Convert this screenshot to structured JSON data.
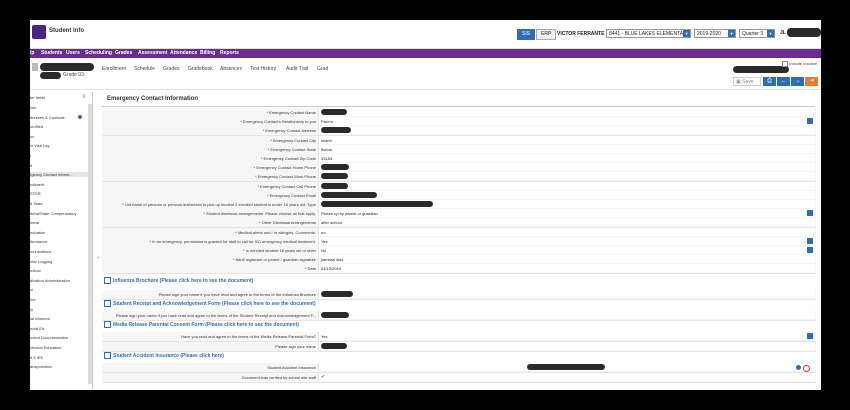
{
  "app": {
    "title": "Student Info"
  },
  "topbar": {
    "btn_sis": "SIS",
    "btn_erp": "ERP",
    "user_name": "VICTOR FERRANTE",
    "school": "8441 - BLUE LAKES ELEMENTA...",
    "year": "2019-2020",
    "quarter": "Quarter 3",
    "trailing_initial": "JL"
  },
  "nav": [
    "Students",
    "Users",
    "Scheduling",
    "Grades",
    "Assessment",
    "Attendance",
    "Billing",
    "Reports"
  ],
  "student": {
    "grade": "Grade 03"
  },
  "subtabs": [
    "Enrollment",
    "Schedule",
    "Grades",
    "Gradebook",
    "Absences",
    "Test History",
    "Audit Trail",
    "Grad"
  ],
  "include_inactive": "Include Inactive",
  "toolbar": {
    "save": "Save"
  },
  "sidebar": {
    "filter_label": "ter fields",
    "items": [
      "info",
      "dresses & Contacts",
      "orofiled",
      "on",
      "lo Visit Log",
      "l",
      "d",
      "rgency Contact Inform...",
      "rollment",
      "STER",
      "d State",
      "deral/State Compensatory",
      "neral",
      "eduation",
      "ttendance",
      "munications",
      "nter Logging",
      "edical",
      "dication Administration",
      "ol",
      "her",
      "ty",
      "ial Workers",
      "ecial Ed",
      "udent Documentation",
      "chnical Education",
      "d 5 IEE",
      "ansportation"
    ]
  },
  "section": {
    "title": "Emergency Contact Information"
  },
  "rows": [
    {
      "label": "* Emergency Contact Name",
      "value": "",
      "redacted": true
    },
    {
      "label": "* Emergency Contact's Relationship to you",
      "value": "Parent",
      "dropdown": true
    },
    {
      "label": "* Emergency Contact Address",
      "value": "",
      "redacted": true
    },
    {
      "label": "* Emergency Contact City",
      "value": "miami"
    },
    {
      "label": "* Emergency Contact State",
      "value": "florida"
    },
    {
      "label": "* Emergency Contact Zip Code",
      "value": "33183"
    },
    {
      "label": "* Emergency Contact Home Phone",
      "value": "",
      "redacted": true
    },
    {
      "label": "* Emergency Contact Work Phone",
      "value": "",
      "redacted": true
    },
    {
      "label": "* Emergency Contact Cell Phone",
      "value": "",
      "redacted": true
    },
    {
      "label": "* Emergency Contact Email",
      "value": "",
      "redacted": true
    },
    {
      "label": "* List name of persons or persons authorized to pick up student if enrolled student is under 18 years old. Type",
      "value": "",
      "redacted": true
    },
    {
      "label": "* Student dismissal arrangements. Please choose all that apply.",
      "value": "Picked up by parent or guardian",
      "dropdown": true
    },
    {
      "label": "* Other Dismissal Arrangements",
      "value": "after school"
    },
    {
      "label": "* Medical alerts and / or allergies. Comments.",
      "value": "no"
    },
    {
      "label": "* In an emergency, permission is granted for staff to call for 911 emergency medical treatment.",
      "value": "Yes",
      "dropdown": true
    },
    {
      "label": "* Is enrolled student 18 years old or older",
      "value": "No",
      "dropdown": true
    },
    {
      "label": "* Adult registrant or parent / guardian signature",
      "value": "yamaris diaz"
    },
    {
      "label": "* Date",
      "value": "04/15/2019"
    }
  ],
  "links": {
    "influenza": "Influenza Brochure (Please click here to see the document)",
    "influenza_sign": "Please sign your name if you have read and agree to the terms of the Influenza Brochure",
    "receipt": "Student Receipt and Acknowledgement Form (Please click here to see the document)",
    "receipt_sign": "Please sign your name if you have read and agree to the terms of the Student Receipt and Acknowledgement F...",
    "media": "Media Release Parental Consent Form (Please click here to see the document)",
    "media_q": "Have you read and agree to the terms of the Media Release Parental Form?",
    "media_q_val": "Yes",
    "media_sign": "Please sign your name",
    "insurance": "Student Accident Insurance (Please click here)",
    "insurance_label": "Student Accident Insurance",
    "verified_label": "Document was verified by school site staff"
  }
}
